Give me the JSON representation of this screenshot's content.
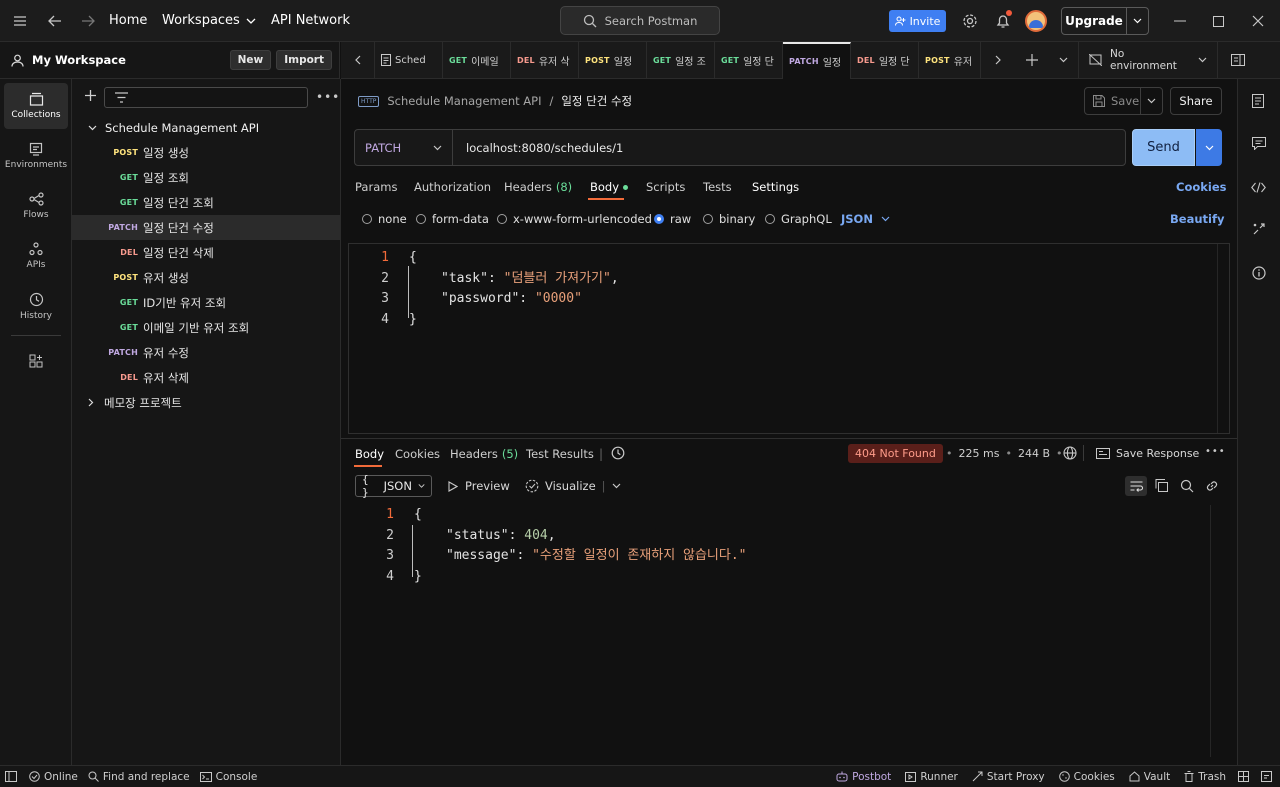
{
  "topbar": {
    "home": "Home",
    "workspaces": "Workspaces",
    "api_network": "API Network",
    "search_placeholder": "Search Postman",
    "invite": "Invite",
    "upgrade": "Upgrade"
  },
  "workspace": {
    "name": "My Workspace",
    "new_label": "New",
    "import_label": "Import"
  },
  "rail": [
    {
      "label": "Collections",
      "icon": "collections-icon"
    },
    {
      "label": "Environments",
      "icon": "environments-icon"
    },
    {
      "label": "Flows",
      "icon": "flows-icon"
    },
    {
      "label": "APIs",
      "icon": "apis-icon"
    },
    {
      "label": "History",
      "icon": "history-icon"
    }
  ],
  "tree": {
    "collection": "Schedule Management API",
    "items": [
      {
        "method": "POST",
        "name": "일정 생성"
      },
      {
        "method": "GET",
        "name": "일정 조회"
      },
      {
        "method": "GET",
        "name": "일정 단건 조회"
      },
      {
        "method": "PATCH",
        "name": "일정 단건 수정"
      },
      {
        "method": "DEL",
        "name": "일정 단건 삭제"
      },
      {
        "method": "POST",
        "name": "유저 생성"
      },
      {
        "method": "GET",
        "name": "ID기반 유저 조회"
      },
      {
        "method": "GET",
        "name": "이메일 기반 유저 조회"
      },
      {
        "method": "PATCH",
        "name": "유저 수정"
      },
      {
        "method": "DEL",
        "name": "유저 삭제"
      }
    ],
    "collection2": "메모장 프로젝트"
  },
  "tabs": [
    {
      "method": "",
      "name": "Sched"
    },
    {
      "method": "GET",
      "name": "이메일"
    },
    {
      "method": "DEL",
      "name": "유저 삭"
    },
    {
      "method": "POST",
      "name": "일정"
    },
    {
      "method": "GET",
      "name": "일정 조"
    },
    {
      "method": "GET",
      "name": "일정 단"
    },
    {
      "method": "PATCH",
      "name": "일정"
    },
    {
      "method": "DEL",
      "name": "일정 단"
    },
    {
      "method": "POST",
      "name": "유저"
    }
  ],
  "environment": "No environment",
  "request": {
    "breadcrumb_collection": "Schedule Management API",
    "breadcrumb_sep": "/",
    "title": "일정 단건 수정",
    "save": "Save",
    "share": "Share",
    "method": "PATCH",
    "url": "localhost:8080/schedules/1",
    "send": "Send",
    "tabs": {
      "params": "Params",
      "authorization": "Authorization",
      "headers": "Headers",
      "headers_count": "(8)",
      "body": "Body",
      "scripts": "Scripts",
      "tests": "Tests",
      "settings": "Settings",
      "cookies": "Cookies"
    },
    "body_types": {
      "none": "none",
      "form_data": "form-data",
      "urlencoded": "x-www-form-urlencoded",
      "raw": "raw",
      "binary": "binary",
      "graphql": "GraphQL",
      "format": "JSON",
      "beautify": "Beautify"
    },
    "code": {
      "l1": "{",
      "k1": "\"task\"",
      "v1": "\"덤블러 가져가기\"",
      "k2": "\"password\"",
      "v2": "\"0000\"",
      "l4": "}"
    }
  },
  "response": {
    "tabs": {
      "body": "Body",
      "cookies": "Cookies",
      "headers": "Headers",
      "headers_count": "(5)",
      "test_results": "Test Results"
    },
    "status": "404 Not Found",
    "time": "225 ms",
    "size": "244 B",
    "save_response": "Save Response",
    "format": "JSON",
    "preview": "Preview",
    "visualize": "Visualize",
    "code": {
      "l1": "{",
      "k1": "\"status\"",
      "v1": "404",
      "k2": "\"message\"",
      "v2": "\"수정할 일정이 존재하지 않습니다.\"",
      "l4": "}"
    }
  },
  "statusbar": {
    "online": "Online",
    "find_replace": "Find and replace",
    "console": "Console",
    "postbot": "Postbot",
    "runner": "Runner",
    "start_proxy": "Start Proxy",
    "cookies": "Cookies",
    "vault": "Vault",
    "trash": "Trash"
  }
}
